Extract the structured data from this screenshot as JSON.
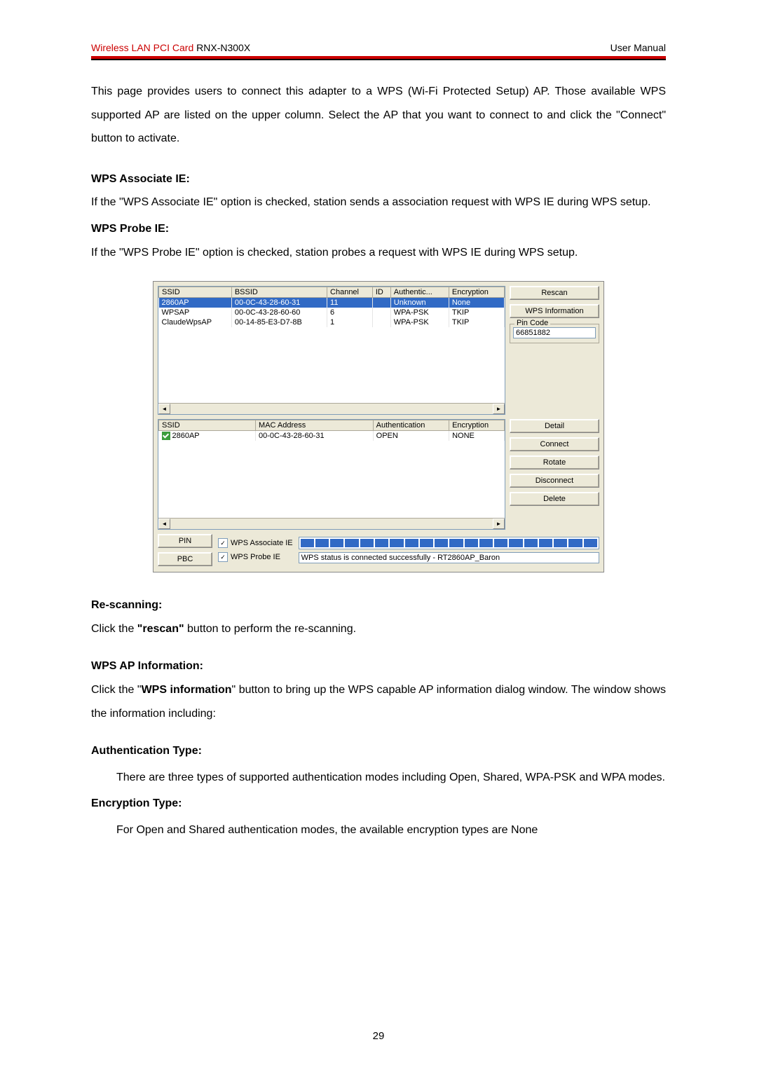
{
  "header": {
    "title_red": "Wireless LAN PCI Card",
    "title_model": " RNX-N300X",
    "right": "User Manual"
  },
  "intro": "This page provides users to connect this adapter to a WPS (Wi-Fi Protected Setup) AP. Those available WPS supported AP are listed on the upper column. Select the AP that you want to connect to and click the \"Connect\" button to activate.",
  "sections": {
    "wps_assoc_title": "WPS Associate IE:",
    "wps_assoc_body": "If the \"WPS Associate IE\" option is checked, station sends a association request with WPS IE during WPS setup.",
    "wps_probe_title": "WPS Probe IE:",
    "wps_probe_body": "If the \"WPS Probe IE\" option is checked, station probes a request with WPS IE during WPS setup.",
    "rescan_title": "Re-scanning:",
    "rescan_body_pre": "Click the ",
    "rescan_body_bold": "\"rescan\"",
    "rescan_body_post": " button to perform the re-scanning.",
    "wps_info_title": "WPS AP Information:",
    "wps_info_pre": "Click the \"",
    "wps_info_bold": "WPS information",
    "wps_info_post": "\" button to bring up the WPS capable AP information dialog window. The window shows the information including:",
    "auth_title": "Authentication Type:",
    "auth_body": "There are three types of supported authentication modes including Open, Shared, WPA-PSK and WPA modes.",
    "enc_title": "Encryption Type:",
    "enc_body": "For Open and Shared authentication modes, the available encryption types are None"
  },
  "screenshot": {
    "top_headers": [
      "SSID",
      "BSSID",
      "Channel",
      "ID",
      "Authentic...",
      "Encryption"
    ],
    "top_rows": [
      {
        "ssid": "2860AP",
        "bssid": "00-0C-43-28-60-31",
        "ch": "11",
        "id": "",
        "auth": "Unknown",
        "enc": "None",
        "selected": true
      },
      {
        "ssid": "WPSAP",
        "bssid": "00-0C-43-28-60-60",
        "ch": "6",
        "id": "",
        "auth": "WPA-PSK",
        "enc": "TKIP",
        "selected": false
      },
      {
        "ssid": "ClaudeWpsAP",
        "bssid": "00-14-85-E3-D7-8B",
        "ch": "1",
        "id": "",
        "auth": "WPA-PSK",
        "enc": "TKIP",
        "selected": false
      }
    ],
    "btn_rescan": "Rescan",
    "btn_wps_info": "WPS Information",
    "pin_label": "Pin Code",
    "pin_value": "66851882",
    "bottom_headers": [
      "SSID",
      "MAC Address",
      "Authentication",
      "Encryption"
    ],
    "bottom_rows": [
      {
        "ssid": "2860AP",
        "mac": "00-0C-43-28-60-31",
        "auth": "OPEN",
        "enc": "NONE"
      }
    ],
    "btn_detail": "Detail",
    "btn_connect": "Connect",
    "btn_rotate": "Rotate",
    "btn_disconnect": "Disconnect",
    "btn_delete": "Delete",
    "btn_pin": "PIN",
    "btn_pbc": "PBC",
    "chk_assoc": "WPS Associate IE",
    "chk_probe": "WPS Probe IE",
    "status": "WPS status is connected successfully - RT2860AP_Baron"
  },
  "page_number": "29"
}
